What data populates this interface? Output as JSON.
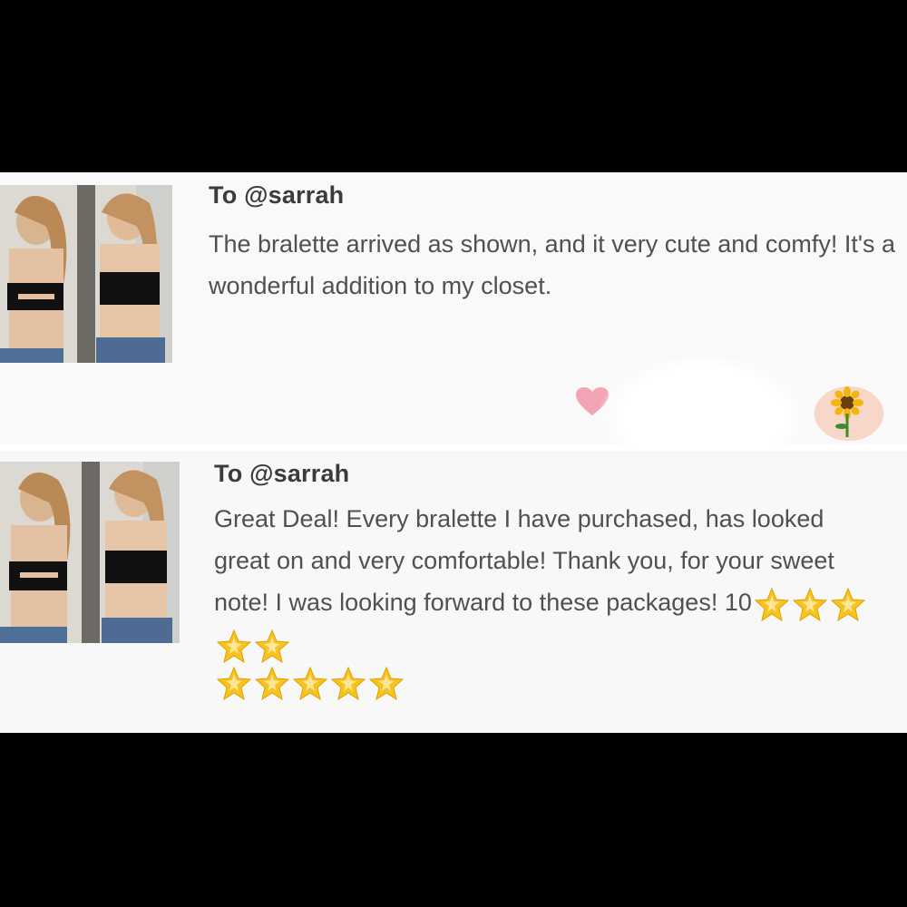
{
  "reviews": [
    {
      "recipient": "To @sarrah",
      "text": "The bralette arrived as shown, and it very cute and comfy! It's a wonderful addition to my closet.",
      "thumbnail": "product-photo",
      "liked": true,
      "avatar": "sunflower-avatar"
    },
    {
      "recipient": "To @sarrah",
      "text": "Great Deal! Every bralette I have purchased, has looked great on and very comfortable! Thank you, for your sweet note! I was looking forward to these packages! 10",
      "thumbnail": "product-photo",
      "stars": 10
    }
  ],
  "colors": {
    "heart": "#f4a3b4",
    "star": "#f7c31e",
    "text": "#505050"
  }
}
